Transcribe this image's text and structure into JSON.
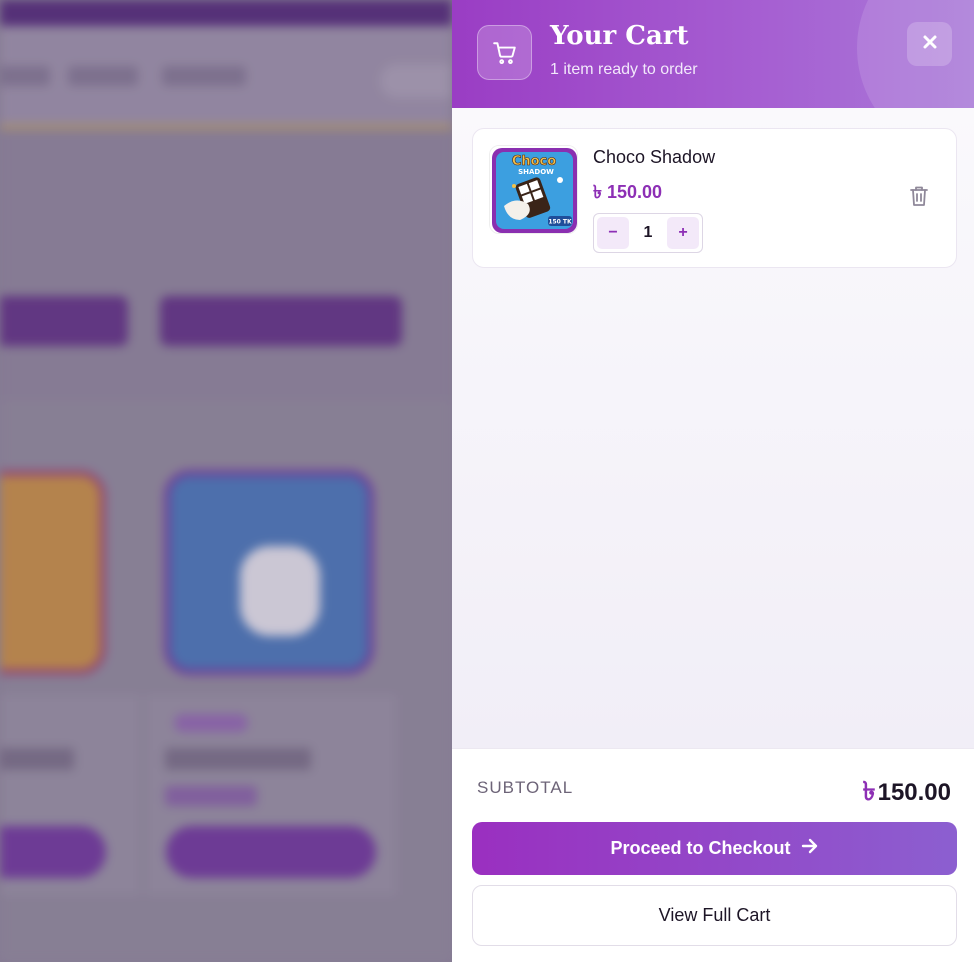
{
  "cart": {
    "title": "Your Cart",
    "subtitle": "1 item ready to order",
    "icons": {
      "header": "cart-icon",
      "close": "close-icon",
      "remove": "trash-icon",
      "checkout_arrow": "arrow-right-icon"
    },
    "items": [
      {
        "name": "Choco Shadow",
        "price": "৳ 150.00",
        "quantity": "1",
        "image": {
          "brand": "Choco",
          "flavor": "SHADOW",
          "price_tag": "150 TK"
        }
      }
    ],
    "qty_minus": "−",
    "qty_plus": "+",
    "subtotal_label": "SUBTOTAL",
    "currency_symbol": "৳",
    "subtotal_value": "150.00",
    "checkout_label": "Proceed to Checkout",
    "view_cart_label": "View Full Cart"
  },
  "colors": {
    "accent": "#8d2fb5",
    "header_gradient_start": "#9a3dc4",
    "header_gradient_end": "#a97ad8",
    "text": "#1d1526"
  }
}
